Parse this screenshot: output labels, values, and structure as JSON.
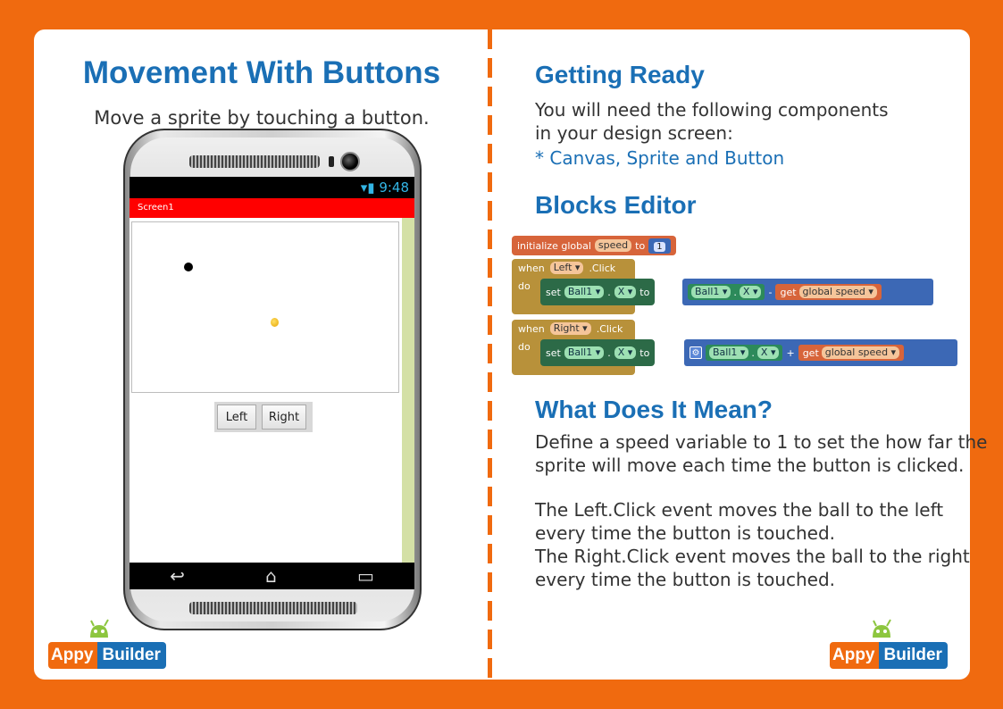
{
  "left": {
    "title": "Movement With Buttons",
    "subtitle": "Move a sprite by touching a button."
  },
  "phone": {
    "time": "9:48",
    "screen_title": "Screen1",
    "left_button": "Left",
    "right_button": "Right"
  },
  "right": {
    "getting_ready_heading": "Getting Ready",
    "getting_ready_text": "You will need the following components\nin your design screen:",
    "components": "* Canvas,  Sprite and Button",
    "blocks_heading": "Blocks Editor",
    "meaning_heading": "What Does It Mean?",
    "meaning_p1": "Define a speed variable to 1 to set the how far the\nsprite will move each time the button is clicked.",
    "meaning_p2": "The Left.Click event moves the ball to the left\nevery time the button is touched.\nThe Right.Click event moves the ball to the right\nevery time the button is touched."
  },
  "blocks": {
    "init_label": "initialize global",
    "init_var": "speed",
    "init_to": "to",
    "init_value": "1",
    "when": "when",
    "do": "do",
    "left_comp": "Left ▾",
    "right_comp": "Right ▾",
    "click": ".Click",
    "set": "set",
    "ball": "Ball1 ▾",
    "dot": ".",
    "x": "X ▾",
    "to": "to",
    "minus": "-",
    "plus": "+",
    "get": "get",
    "global_speed": "global speed ▾"
  },
  "logo": {
    "appy": "Appy",
    "builder": "Builder"
  },
  "colors": {
    "background": "#f06a0f",
    "heading": "#1a6fb5"
  }
}
